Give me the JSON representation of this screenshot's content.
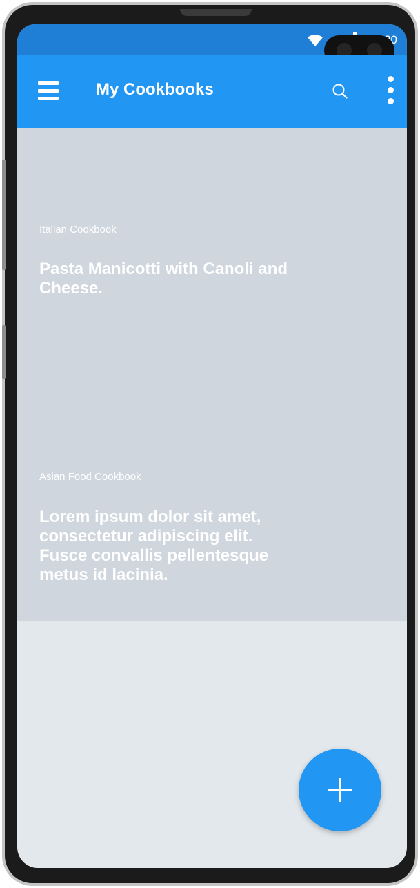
{
  "status_bar": {
    "time": "11:30",
    "icons": [
      "wifi-icon",
      "signal-icon",
      "battery-icon"
    ]
  },
  "app_bar": {
    "title": "My Cookbooks",
    "menu_icon": "menu-icon",
    "search_icon": "search-icon",
    "more_icon": "more-vert-icon"
  },
  "cookbooks": [
    {
      "overline": "Italian Cookbook",
      "title": "Pasta Manicotti with Canoli and Cheese."
    },
    {
      "overline": "Asian Food Cookbook",
      "title": "Lorem ipsum dolor sit amet, consectetur adipiscing elit. Fusce convallis pellentesque metus id lacinia."
    }
  ],
  "fab": {
    "icon": "plus-icon"
  },
  "colors": {
    "status_bar": "#1f7fd7",
    "app_bar": "#2196f3",
    "card_background": "#cfd6dd",
    "screen_background": "#e3e8ec",
    "fab": "#2196f3"
  }
}
